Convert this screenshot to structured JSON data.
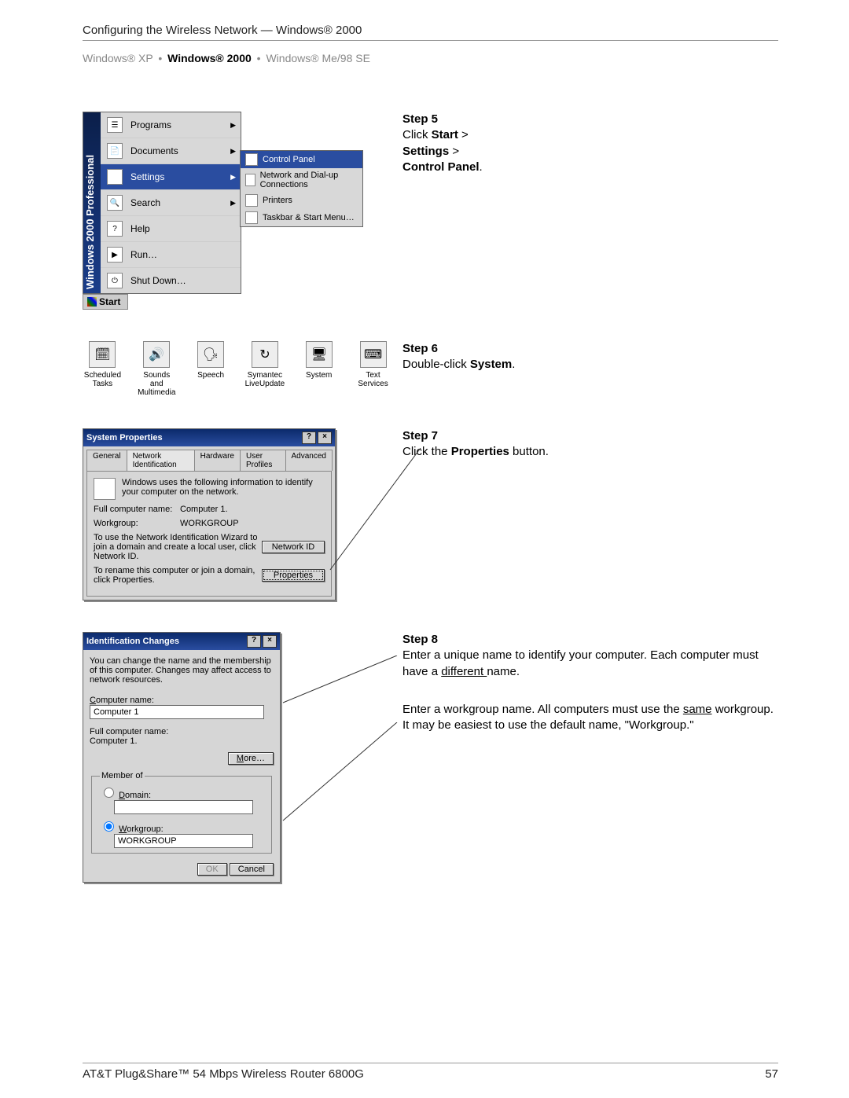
{
  "header": {
    "title": "Configuring the Wireless Network — Windows® 2000",
    "breadcrumbs": {
      "xp": "Windows® XP",
      "w2k": "Windows® 2000",
      "me98": "Windows® Me/98 SE"
    }
  },
  "startmenu": {
    "sidebar": "Windows 2000 Professional",
    "items": [
      "Programs",
      "Documents",
      "Settings",
      "Search",
      "Help",
      "Run…",
      "Shut Down…"
    ],
    "start_label": "Start",
    "submenu": [
      "Control Panel",
      "Network and Dial-up Connections",
      "Printers",
      "Taskbar & Start Menu…"
    ]
  },
  "step5": {
    "label": "Step 5",
    "text1": "Click ",
    "bold1": "Start",
    "text2": " > ",
    "bold2": "Settings",
    "text3": " > ",
    "bold3": "Control Panel",
    "text4": "."
  },
  "cp_icons": [
    "Scheduled Tasks",
    "Sounds and Multimedia",
    "Speech",
    "Symantec LiveUpdate",
    "System",
    "Text Services"
  ],
  "step6": {
    "label": "Step 6",
    "text1": "Double-click ",
    "bold1": "System",
    "text2": "."
  },
  "sysprops": {
    "title": "System Properties",
    "tabs": [
      "General",
      "Network Identification",
      "Hardware",
      "User Profiles",
      "Advanced"
    ],
    "desc": "Windows uses the following information to identify your computer on the network.",
    "full_name_lbl": "Full computer name:",
    "full_name_val": "Computer 1.",
    "workgroup_lbl": "Workgroup:",
    "workgroup_val": "WORKGROUP",
    "wizard_text": "To use the Network Identification Wizard to join a domain and create a local user, click Network ID.",
    "netid_btn": "Network ID",
    "rename_text": "To rename this computer or join a domain, click Properties.",
    "props_btn": "Properties"
  },
  "step7": {
    "label": "Step 7",
    "text1": "Click the ",
    "bold1": "Properties",
    "text2": " button."
  },
  "idchanges": {
    "title": "Identification Changes",
    "desc": "You can change the name and the membership of this computer. Changes may affect access to network resources.",
    "comp_name_lbl": "Computer name:",
    "comp_name_val": "Computer 1",
    "full_name_lbl": "Full computer name:",
    "full_name_val": "Computer 1.",
    "more_btn": "More…",
    "member_of": "Member of",
    "domain_lbl": "Domain:",
    "workgroup_lbl": "Workgroup:",
    "workgroup_val": "WORKGROUP",
    "ok": "OK",
    "cancel": "Cancel"
  },
  "step8": {
    "label": "Step 8",
    "p1a": "Enter a unique name to identify your computer. Each computer must have a ",
    "p1u": "different ",
    "p1b": "name.",
    "p2a": "Enter a workgroup name. All computers must use the ",
    "p2u": "same",
    "p2b": " workgroup. It may be easiest to use the default name, \"Workgroup.\""
  },
  "footer": {
    "left": "AT&T Plug&Share™ 54 Mbps Wireless Router 6800G",
    "right": "57"
  }
}
